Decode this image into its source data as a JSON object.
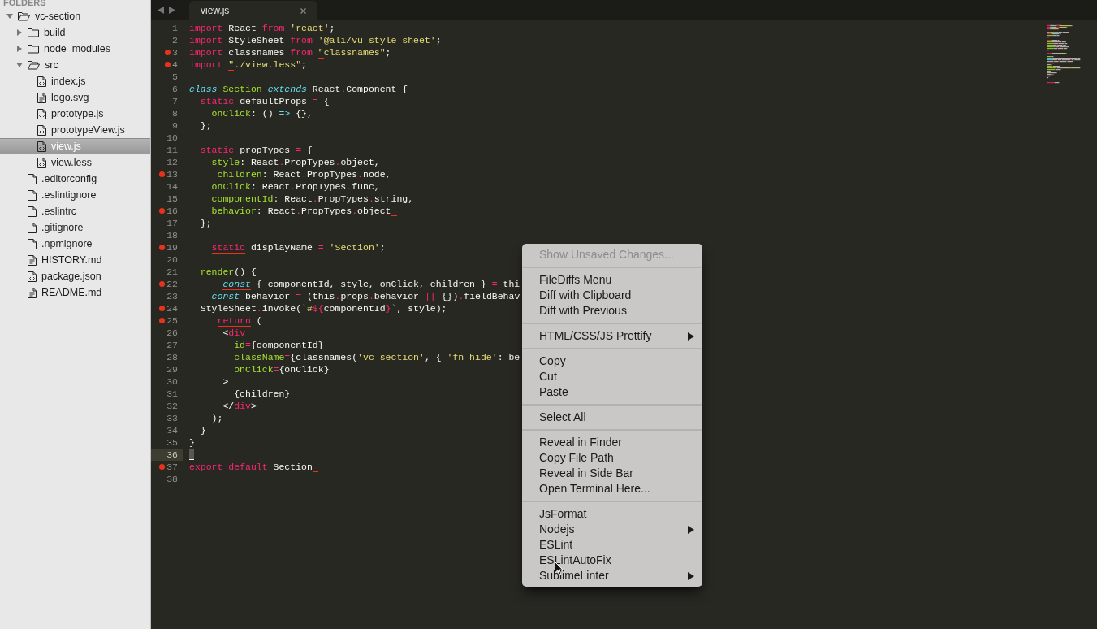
{
  "sidebar": {
    "header": "FOLDERS",
    "tree": [
      {
        "label": "vc-section",
        "kind": "folder",
        "expanded": true,
        "selected": false,
        "children": [
          {
            "label": "build",
            "kind": "folder",
            "expanded": false,
            "selected": false
          },
          {
            "label": "node_modules",
            "kind": "folder",
            "expanded": false,
            "selected": false
          },
          {
            "label": "src",
            "kind": "folder",
            "expanded": true,
            "selected": false,
            "children": [
              {
                "label": "index.js",
                "kind": "code-file",
                "selected": false
              },
              {
                "label": "logo.svg",
                "kind": "text-file",
                "selected": false
              },
              {
                "label": "prototype.js",
                "kind": "code-file",
                "selected": false
              },
              {
                "label": "prototypeView.js",
                "kind": "code-file",
                "selected": false
              },
              {
                "label": "view.js",
                "kind": "code-file",
                "selected": true
              },
              {
                "label": "view.less",
                "kind": "code-file",
                "selected": false
              }
            ]
          },
          {
            "label": ".editorconfig",
            "kind": "plain-file",
            "selected": false
          },
          {
            "label": ".eslintignore",
            "kind": "plain-file",
            "selected": false
          },
          {
            "label": ".eslintrc",
            "kind": "plain-file",
            "selected": false
          },
          {
            "label": ".gitignore",
            "kind": "plain-file",
            "selected": false
          },
          {
            "label": ".npmignore",
            "kind": "plain-file",
            "selected": false
          },
          {
            "label": "HISTORY.md",
            "kind": "text-file",
            "selected": false
          },
          {
            "label": "package.json",
            "kind": "code-file",
            "selected": false
          },
          {
            "label": "README.md",
            "kind": "text-file",
            "selected": false
          }
        ]
      }
    ]
  },
  "tabs": [
    {
      "label": "view.js",
      "selected": true
    }
  ],
  "editor": {
    "lines": [
      {
        "number": "1",
        "marked": false,
        "current": false,
        "trailing_flag": false,
        "tokens": [
          {
            "text": "import",
            "kind": "keyword",
            "flagged": false
          },
          {
            "text": " React ",
            "kind": "text",
            "flagged": false
          },
          {
            "text": "from",
            "kind": "keyword",
            "flagged": false
          },
          {
            "text": " 'react'",
            "kind": "string",
            "flagged": false
          },
          {
            "text": ";",
            "kind": "text",
            "flagged": false
          }
        ]
      },
      {
        "number": "2",
        "marked": false,
        "current": false,
        "trailing_flag": false,
        "tokens": [
          {
            "text": "import",
            "kind": "keyword",
            "flagged": false
          },
          {
            "text": " StyleSheet ",
            "kind": "text",
            "flagged": false
          },
          {
            "text": "from",
            "kind": "keyword",
            "flagged": false
          },
          {
            "text": " '@ali/vu-style-sheet'",
            "kind": "string",
            "flagged": false
          },
          {
            "text": ";",
            "kind": "text",
            "flagged": false
          }
        ]
      },
      {
        "number": "3",
        "marked": true,
        "current": false,
        "trailing_flag": false,
        "tokens": [
          {
            "text": "import",
            "kind": "keyword",
            "flagged": false
          },
          {
            "text": " classnames ",
            "kind": "text",
            "flagged": false
          },
          {
            "text": "from",
            "kind": "keyword",
            "flagged": false
          },
          {
            "text": " \"",
            "kind": "string",
            "flagged": true
          },
          {
            "text": "classnames\"",
            "kind": "string",
            "flagged": false
          },
          {
            "text": ";",
            "kind": "text",
            "flagged": false
          }
        ]
      },
      {
        "number": "4",
        "marked": true,
        "current": false,
        "trailing_flag": false,
        "tokens": [
          {
            "text": "import",
            "kind": "keyword",
            "flagged": false
          },
          {
            "text": " \"",
            "kind": "string",
            "flagged": true
          },
          {
            "text": "./view.less\"",
            "kind": "string",
            "flagged": false
          },
          {
            "text": ";",
            "kind": "text",
            "flagged": false
          }
        ]
      },
      {
        "number": "5",
        "marked": false,
        "current": false,
        "trailing_flag": false
      },
      {
        "number": "6",
        "marked": false,
        "current": false,
        "trailing_flag": false,
        "tokens": [
          {
            "text": "class",
            "kind": "storage",
            "flagged": false
          },
          {
            "text": " Section",
            "kind": "entity",
            "flagged": false
          },
          {
            "text": " extends",
            "kind": "storage",
            "flagged": false
          },
          {
            "text": " React",
            "kind": "text",
            "flagged": false
          },
          {
            "text": ".",
            "kind": "keyword",
            "flagged": false
          },
          {
            "text": "Component {",
            "kind": "text",
            "flagged": false
          }
        ]
      },
      {
        "number": "7",
        "marked": false,
        "current": false,
        "trailing_flag": false,
        "tokens": [
          {
            "text": "  static",
            "kind": "keyword",
            "flagged": false
          },
          {
            "text": " defaultProps ",
            "kind": "text",
            "flagged": false
          },
          {
            "text": "=",
            "kind": "keyword",
            "flagged": false
          },
          {
            "text": " {",
            "kind": "text",
            "flagged": false
          }
        ]
      },
      {
        "number": "8",
        "marked": false,
        "current": false,
        "trailing_flag": false,
        "tokens": [
          {
            "text": "    onClick",
            "kind": "entity",
            "flagged": false
          },
          {
            "text": ": () ",
            "kind": "text",
            "flagged": false
          },
          {
            "text": "=>",
            "kind": "arrow",
            "flagged": false
          },
          {
            "text": " {},",
            "kind": "text",
            "flagged": false
          }
        ]
      },
      {
        "number": "9",
        "marked": false,
        "current": false,
        "trailing_flag": false,
        "tokens": [
          {
            "text": "  };",
            "kind": "text",
            "flagged": false
          }
        ]
      },
      {
        "number": "10",
        "marked": false,
        "current": false,
        "trailing_flag": false
      },
      {
        "number": "11",
        "marked": false,
        "current": false,
        "trailing_flag": false,
        "tokens": [
          {
            "text": "  static",
            "kind": "keyword",
            "flagged": false
          },
          {
            "text": " propTypes ",
            "kind": "text",
            "flagged": false
          },
          {
            "text": "=",
            "kind": "keyword",
            "flagged": false
          },
          {
            "text": " {",
            "kind": "text",
            "flagged": false
          }
        ]
      },
      {
        "number": "12",
        "marked": false,
        "current": false,
        "trailing_flag": false,
        "tokens": [
          {
            "text": "    style",
            "kind": "entity",
            "flagged": false
          },
          {
            "text": ": React",
            "kind": "text",
            "flagged": false
          },
          {
            "text": ".",
            "kind": "keyword",
            "flagged": false
          },
          {
            "text": "PropTypes",
            "kind": "text",
            "flagged": false
          },
          {
            "text": ".",
            "kind": "keyword",
            "flagged": false
          },
          {
            "text": "object,",
            "kind": "text",
            "flagged": false
          }
        ]
      },
      {
        "number": "13",
        "marked": true,
        "current": false,
        "trailing_flag": false,
        "tokens": [
          {
            "text": "     children",
            "kind": "entity",
            "flagged": true
          },
          {
            "text": ": React",
            "kind": "text",
            "flagged": false
          },
          {
            "text": ".",
            "kind": "keyword",
            "flagged": false
          },
          {
            "text": "PropTypes",
            "kind": "text",
            "flagged": false
          },
          {
            "text": ".",
            "kind": "keyword",
            "flagged": false
          },
          {
            "text": "node,",
            "kind": "text",
            "flagged": false
          }
        ]
      },
      {
        "number": "14",
        "marked": false,
        "current": false,
        "trailing_flag": false,
        "tokens": [
          {
            "text": "    onClick",
            "kind": "entity",
            "flagged": false
          },
          {
            "text": ": React",
            "kind": "text",
            "flagged": false
          },
          {
            "text": ".",
            "kind": "keyword",
            "flagged": false
          },
          {
            "text": "PropTypes",
            "kind": "text",
            "flagged": false
          },
          {
            "text": ".",
            "kind": "keyword",
            "flagged": false
          },
          {
            "text": "func,",
            "kind": "text",
            "flagged": false
          }
        ]
      },
      {
        "number": "15",
        "marked": false,
        "current": false,
        "trailing_flag": false,
        "tokens": [
          {
            "text": "    componentId",
            "kind": "entity",
            "flagged": false
          },
          {
            "text": ": React",
            "kind": "text",
            "flagged": false
          },
          {
            "text": ".",
            "kind": "keyword",
            "flagged": false
          },
          {
            "text": "PropTypes",
            "kind": "text",
            "flagged": false
          },
          {
            "text": ".",
            "kind": "keyword",
            "flagged": false
          },
          {
            "text": "string,",
            "kind": "text",
            "flagged": false
          }
        ]
      },
      {
        "number": "16",
        "marked": true,
        "current": false,
        "trailing_flag": true,
        "tokens": [
          {
            "text": "    behavior",
            "kind": "entity",
            "flagged": false
          },
          {
            "text": ": React",
            "kind": "text",
            "flagged": false
          },
          {
            "text": ".",
            "kind": "keyword",
            "flagged": false
          },
          {
            "text": "PropTypes",
            "kind": "text",
            "flagged": false
          },
          {
            "text": ".",
            "kind": "keyword",
            "flagged": false
          },
          {
            "text": "object",
            "kind": "text",
            "flagged": false
          }
        ]
      },
      {
        "number": "17",
        "marked": false,
        "current": false,
        "trailing_flag": false,
        "tokens": [
          {
            "text": "  };",
            "kind": "text",
            "flagged": false
          }
        ]
      },
      {
        "number": "18",
        "marked": false,
        "current": false,
        "trailing_flag": false
      },
      {
        "number": "19",
        "marked": true,
        "current": false,
        "trailing_flag": false,
        "tokens": [
          {
            "text": "    static",
            "kind": "keyword",
            "flagged": true
          },
          {
            "text": " displayName ",
            "kind": "text",
            "flagged": false
          },
          {
            "text": "=",
            "kind": "keyword",
            "flagged": false
          },
          {
            "text": " 'Section'",
            "kind": "string",
            "flagged": false
          },
          {
            "text": ";",
            "kind": "text",
            "flagged": false
          }
        ]
      },
      {
        "number": "20",
        "marked": false,
        "current": false,
        "trailing_flag": false
      },
      {
        "number": "21",
        "marked": false,
        "current": false,
        "trailing_flag": false,
        "tokens": [
          {
            "text": "  render",
            "kind": "entity",
            "flagged": false
          },
          {
            "text": "() {",
            "kind": "text",
            "flagged": false
          }
        ]
      },
      {
        "number": "22",
        "marked": true,
        "current": false,
        "trailing_flag": false,
        "tokens": [
          {
            "text": "      const",
            "kind": "storage",
            "flagged": true
          },
          {
            "text": " { componentId, style, onClick, children } ",
            "kind": "text",
            "flagged": false
          },
          {
            "text": "=",
            "kind": "keyword",
            "flagged": false
          },
          {
            "text": " thi",
            "kind": "text",
            "flagged": false
          }
        ]
      },
      {
        "number": "23",
        "marked": false,
        "current": false,
        "trailing_flag": false,
        "tokens": [
          {
            "text": "    const",
            "kind": "storage",
            "flagged": false
          },
          {
            "text": " behavior ",
            "kind": "text",
            "flagged": false
          },
          {
            "text": "=",
            "kind": "keyword",
            "flagged": false
          },
          {
            "text": " (this",
            "kind": "text",
            "flagged": false
          },
          {
            "text": ".",
            "kind": "keyword",
            "flagged": false
          },
          {
            "text": "props",
            "kind": "text",
            "flagged": false
          },
          {
            "text": ".",
            "kind": "keyword",
            "flagged": false
          },
          {
            "text": "behavior ",
            "kind": "text",
            "flagged": false
          },
          {
            "text": "||",
            "kind": "keyword",
            "flagged": false
          },
          {
            "text": " {})",
            "kind": "text",
            "flagged": false
          },
          {
            "text": ".",
            "kind": "keyword",
            "flagged": false
          },
          {
            "text": "fieldBehav",
            "kind": "text",
            "flagged": false
          }
        ]
      },
      {
        "number": "24",
        "marked": true,
        "current": false,
        "trailing_flag": false,
        "tokens": [
          {
            "text": "  StyleSheet",
            "kind": "text",
            "flagged": true
          },
          {
            "text": ".",
            "kind": "keyword",
            "flagged": false
          },
          {
            "text": "invoke(",
            "kind": "text",
            "flagged": false
          },
          {
            "text": "`",
            "kind": "muted",
            "flagged": false
          },
          {
            "text": "#",
            "kind": "string",
            "flagged": false
          },
          {
            "text": "${",
            "kind": "keyword",
            "flagged": false
          },
          {
            "text": "componentId",
            "kind": "text",
            "flagged": false
          },
          {
            "text": "}",
            "kind": "keyword",
            "flagged": false
          },
          {
            "text": "`",
            "kind": "muted",
            "flagged": false
          },
          {
            "text": ", style);",
            "kind": "text",
            "flagged": false
          }
        ]
      },
      {
        "number": "25",
        "marked": true,
        "current": false,
        "trailing_flag": false,
        "tokens": [
          {
            "text": "     return",
            "kind": "keyword",
            "flagged": true
          },
          {
            "text": " (",
            "kind": "text",
            "flagged": false
          }
        ]
      },
      {
        "number": "26",
        "marked": false,
        "current": false,
        "trailing_flag": false,
        "tokens": [
          {
            "text": "      <",
            "kind": "text",
            "flagged": false
          },
          {
            "text": "div",
            "kind": "keyword",
            "flagged": false
          }
        ]
      },
      {
        "number": "27",
        "marked": false,
        "current": false,
        "trailing_flag": false,
        "tokens": [
          {
            "text": "        id",
            "kind": "entity",
            "flagged": false
          },
          {
            "text": "=",
            "kind": "keyword",
            "flagged": false
          },
          {
            "text": "{componentId}",
            "kind": "text",
            "flagged": false
          }
        ]
      },
      {
        "number": "28",
        "marked": false,
        "current": false,
        "trailing_flag": false,
        "tokens": [
          {
            "text": "        className",
            "kind": "entity",
            "flagged": false
          },
          {
            "text": "=",
            "kind": "keyword",
            "flagged": false
          },
          {
            "text": "{classnames(",
            "kind": "text",
            "flagged": false
          },
          {
            "text": "'vc-section'",
            "kind": "string",
            "flagged": false
          },
          {
            "text": ", { ",
            "kind": "text",
            "flagged": false
          },
          {
            "text": "'fn-hide'",
            "kind": "string",
            "flagged": false
          },
          {
            "text": ": be",
            "kind": "text",
            "flagged": false
          }
        ]
      },
      {
        "number": "29",
        "marked": false,
        "current": false,
        "trailing_flag": false,
        "tokens": [
          {
            "text": "        onClick",
            "kind": "entity",
            "flagged": false
          },
          {
            "text": "=",
            "kind": "keyword",
            "flagged": false
          },
          {
            "text": "{onClick}",
            "kind": "text",
            "flagged": false
          }
        ]
      },
      {
        "number": "30",
        "marked": false,
        "current": false,
        "trailing_flag": false,
        "tokens": [
          {
            "text": "      >",
            "kind": "text",
            "flagged": false
          }
        ]
      },
      {
        "number": "31",
        "marked": false,
        "current": false,
        "trailing_flag": false,
        "tokens": [
          {
            "text": "        {children}",
            "kind": "text",
            "flagged": false
          }
        ]
      },
      {
        "number": "32",
        "marked": false,
        "current": false,
        "trailing_flag": false,
        "tokens": [
          {
            "text": "      </",
            "kind": "text",
            "flagged": false
          },
          {
            "text": "div",
            "kind": "keyword",
            "flagged": false
          },
          {
            "text": ">",
            "kind": "text",
            "flagged": false
          }
        ]
      },
      {
        "number": "33",
        "marked": false,
        "current": false,
        "trailing_flag": false,
        "tokens": [
          {
            "text": "    );",
            "kind": "text",
            "flagged": false
          }
        ]
      },
      {
        "number": "34",
        "marked": false,
        "current": false,
        "trailing_flag": false,
        "tokens": [
          {
            "text": "  }",
            "kind": "text",
            "flagged": false
          }
        ]
      },
      {
        "number": "35",
        "marked": false,
        "current": false,
        "trailing_flag": false,
        "tokens": [
          {
            "text": "}",
            "kind": "text",
            "flagged": false
          }
        ]
      },
      {
        "number": "36",
        "marked": false,
        "current": true,
        "trailing_flag": false
      },
      {
        "number": "37",
        "marked": true,
        "current": false,
        "trailing_flag": true,
        "tokens": [
          {
            "text": "export",
            "kind": "keyword",
            "flagged": false
          },
          {
            "text": " default",
            "kind": "keyword",
            "flagged": false
          },
          {
            "text": " Section",
            "kind": "text",
            "flagged": false
          }
        ]
      },
      {
        "number": "38",
        "marked": false,
        "current": false,
        "trailing_flag": false
      }
    ]
  },
  "context_menu": {
    "groups": [
      [
        {
          "label": "Show Unsaved Changes...",
          "disabled": true,
          "submenu": false
        }
      ],
      [
        {
          "label": "FileDiffs Menu",
          "disabled": false,
          "submenu": false
        },
        {
          "label": "Diff with Clipboard",
          "disabled": false,
          "submenu": false
        },
        {
          "label": "Diff with Previous",
          "disabled": false,
          "submenu": false
        }
      ],
      [
        {
          "label": "HTML/CSS/JS Prettify",
          "disabled": false,
          "submenu": true
        }
      ],
      [
        {
          "label": "Copy",
          "disabled": false,
          "submenu": false
        },
        {
          "label": "Cut",
          "disabled": false,
          "submenu": false
        },
        {
          "label": "Paste",
          "disabled": false,
          "submenu": false
        }
      ],
      [
        {
          "label": "Select All",
          "disabled": false,
          "submenu": false
        }
      ],
      [
        {
          "label": "Reveal in Finder",
          "disabled": false,
          "submenu": false
        },
        {
          "label": "Copy File Path",
          "disabled": false,
          "submenu": false
        },
        {
          "label": "Reveal in Side Bar",
          "disabled": false,
          "submenu": false
        },
        {
          "label": "Open Terminal Here...",
          "disabled": false,
          "submenu": false
        }
      ],
      [
        {
          "label": "JsFormat",
          "disabled": false,
          "submenu": false
        },
        {
          "label": "Nodejs",
          "disabled": false,
          "submenu": true
        },
        {
          "label": "ESLint",
          "disabled": false,
          "submenu": false
        },
        {
          "label": "ESLintAutoFix",
          "disabled": false,
          "submenu": false
        },
        {
          "label": "SublimeLinter",
          "disabled": false,
          "submenu": true
        }
      ]
    ]
  }
}
